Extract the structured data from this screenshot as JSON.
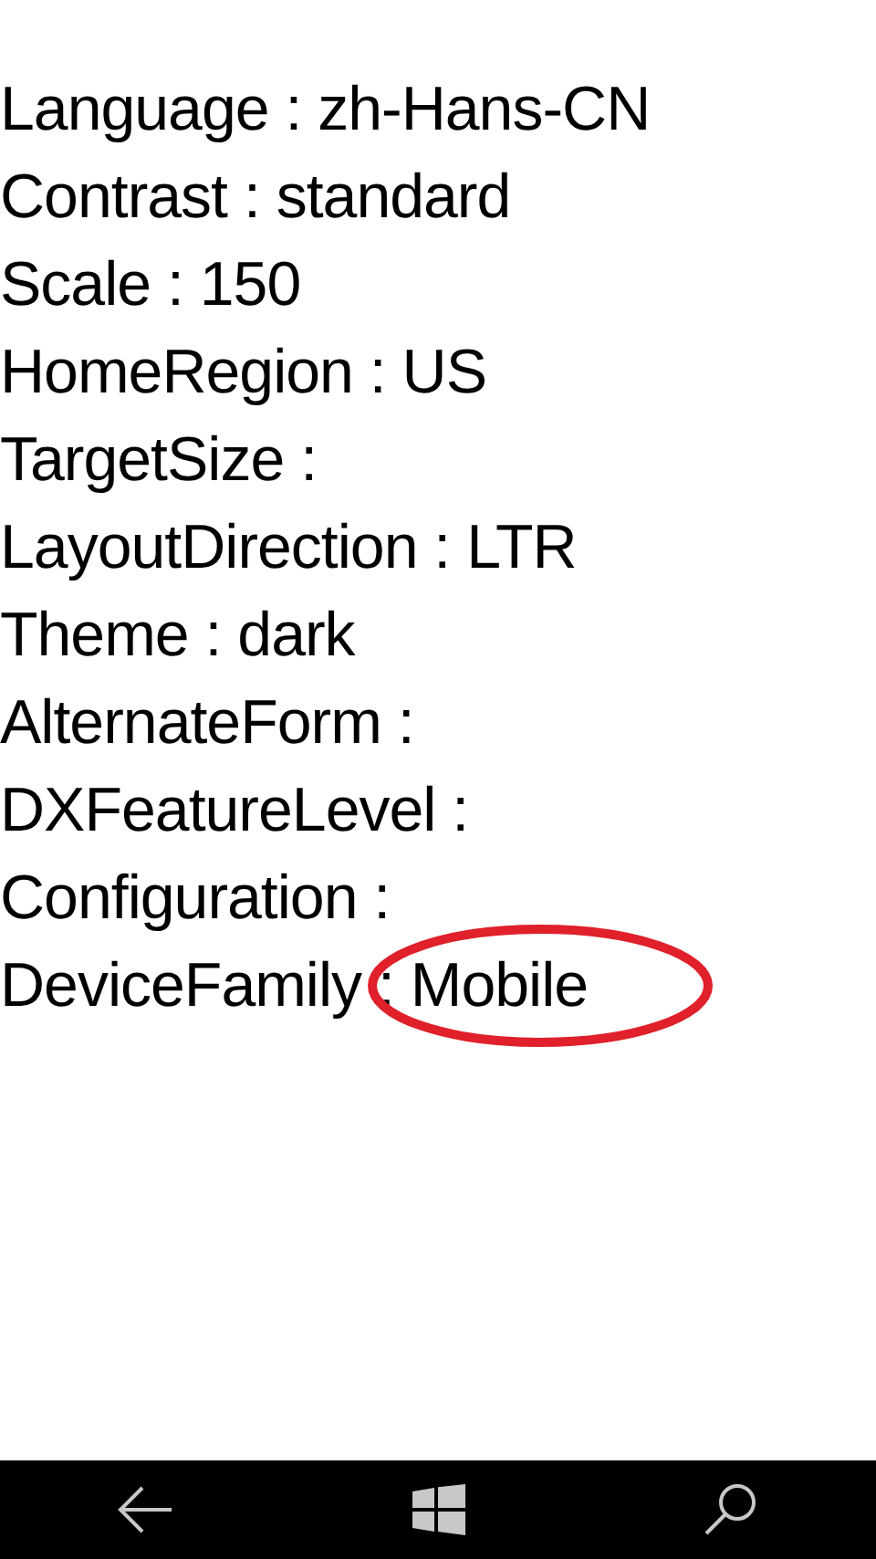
{
  "lines": [
    {
      "text": "Language : zh-Hans-CN",
      "highlighted": false
    },
    {
      "text": "Contrast : standard",
      "highlighted": false
    },
    {
      "text": "Scale : 150",
      "highlighted": false
    },
    {
      "text": "HomeRegion : US",
      "highlighted": false
    },
    {
      "text": "TargetSize :",
      "highlighted": false
    },
    {
      "text": "LayoutDirection : LTR",
      "highlighted": false
    },
    {
      "text": "Theme : dark",
      "highlighted": false
    },
    {
      "text": "AlternateForm :",
      "highlighted": false
    },
    {
      "text": "DXFeatureLevel :",
      "highlighted": false
    },
    {
      "text": "Configuration :",
      "highlighted": false
    },
    {
      "text": "DeviceFamily : Mobile",
      "highlighted": true
    }
  ]
}
